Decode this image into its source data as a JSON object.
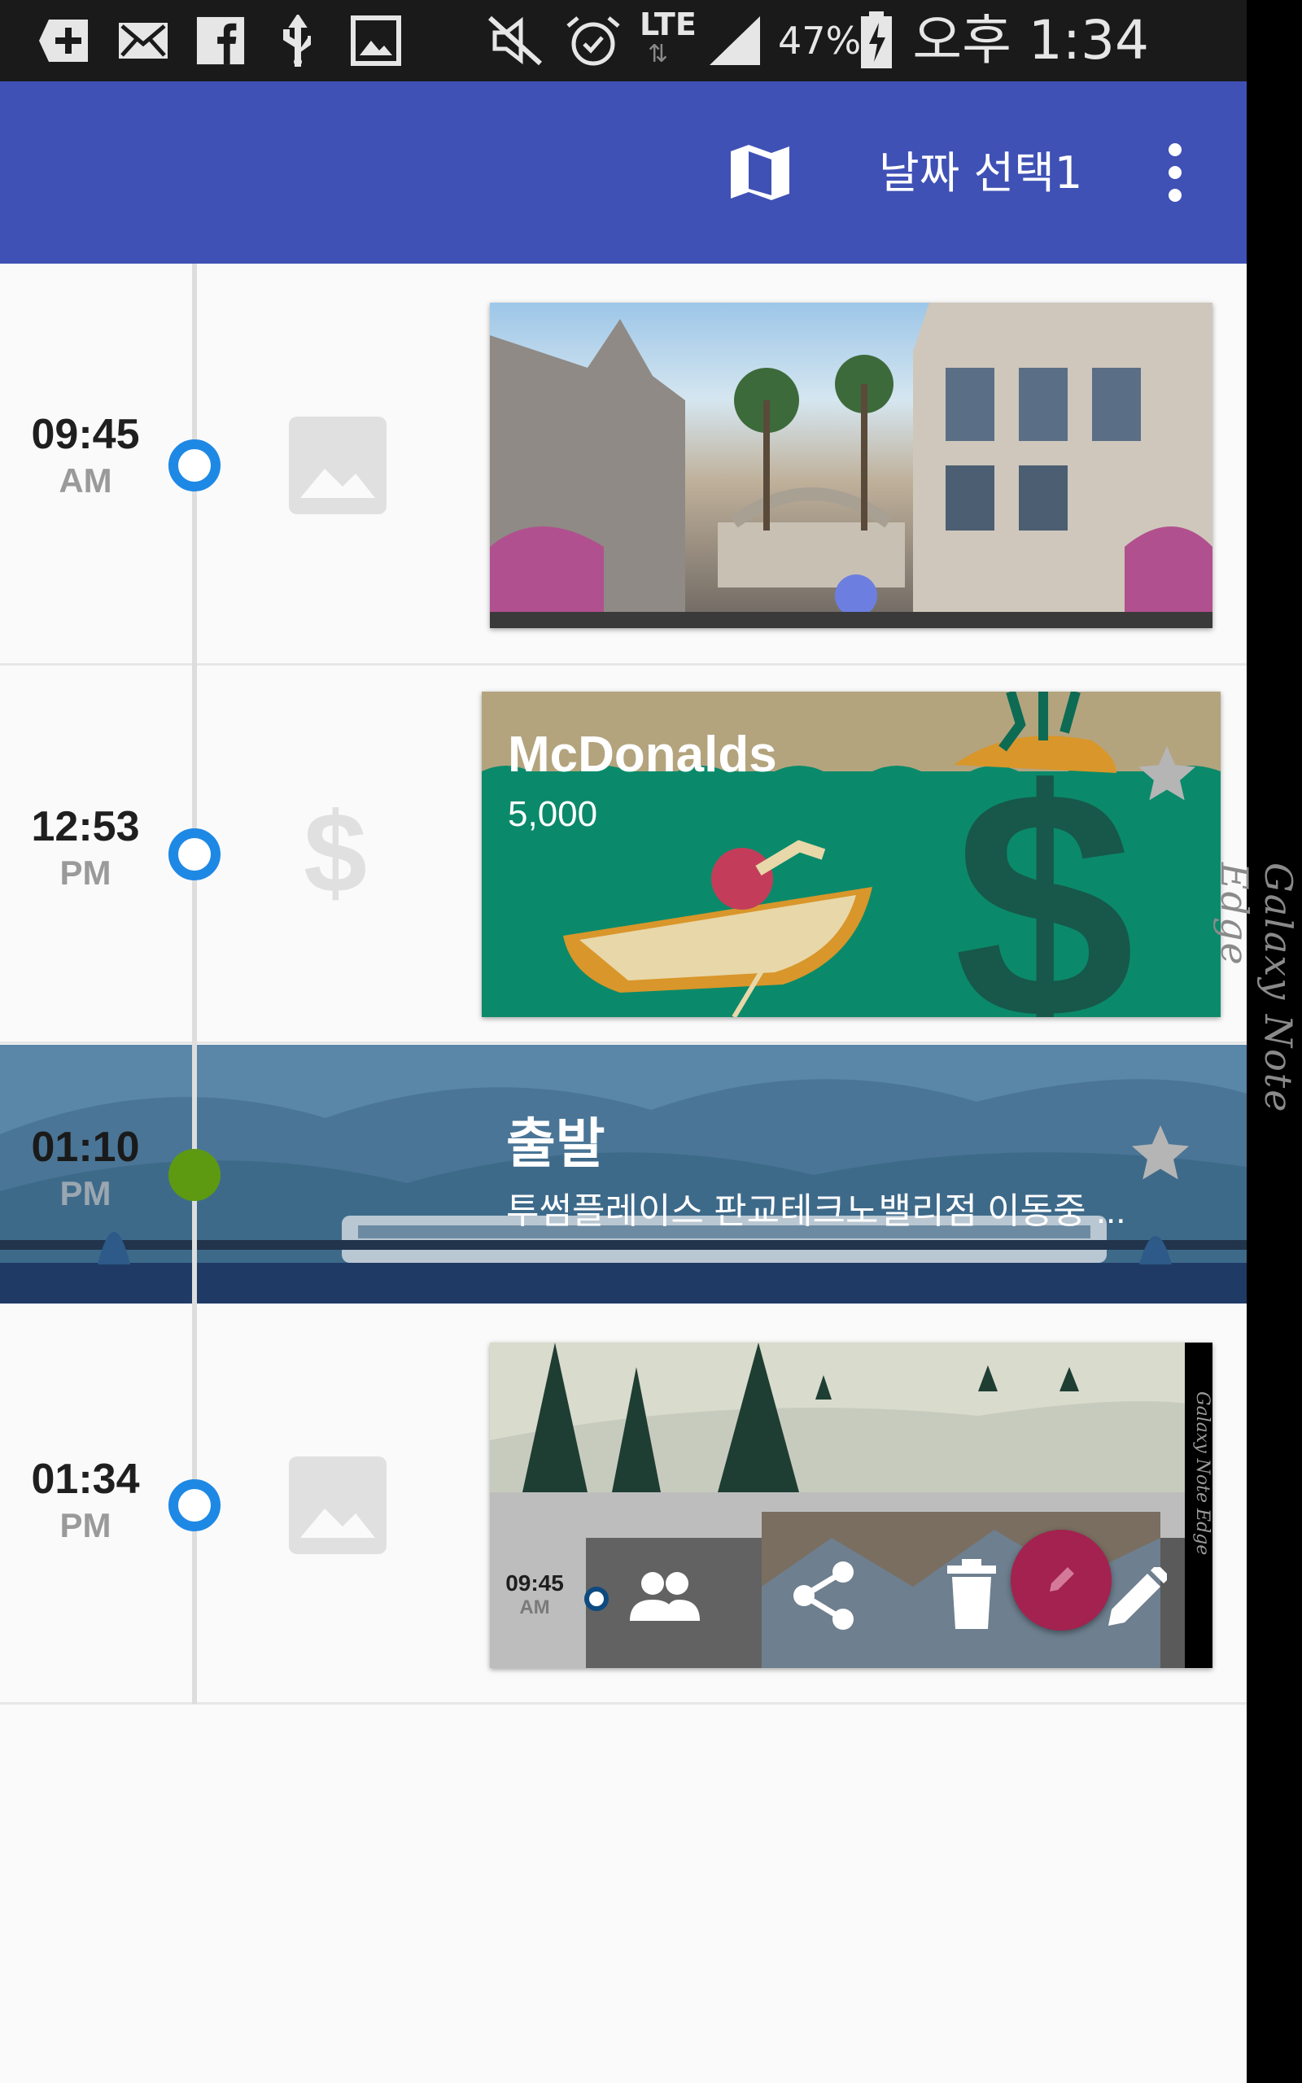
{
  "status_bar": {
    "battery_percent": "47%",
    "network": "LTE",
    "time": "오후 1:34",
    "icons": [
      "add-box-icon",
      "mail-icon",
      "facebook-icon",
      "usb-icon",
      "image-icon",
      "mute-icon",
      "alarm-icon",
      "lte-icon",
      "signal-icon",
      "battery-charging-icon"
    ]
  },
  "app_bar": {
    "map_icon": "map-icon",
    "date_select_label": "날짜 선택1",
    "overflow_icon": "more-vert-icon",
    "color": "#3f51b5"
  },
  "timeline": {
    "items": [
      {
        "time": "09:45",
        "ampm": "AM",
        "type_icon": "image-icon",
        "kind": "photo"
      },
      {
        "time": "12:53",
        "ampm": "PM",
        "type_icon": "dollar-icon",
        "kind": "expense",
        "title": "McDonalds",
        "subtitle": "5,000",
        "star": "star-icon"
      },
      {
        "time": "01:10",
        "ampm": "PM",
        "kind": "movement",
        "title": "출발",
        "subtitle": "투썸플레이스 판교테크노밸리점  이동중 ...",
        "star": "star-icon"
      },
      {
        "time": "01:34",
        "ampm": "PM",
        "type_icon": "image-icon",
        "kind": "photo"
      }
    ]
  },
  "nested_screenshot": {
    "time": "09:45",
    "ampm": "AM",
    "actions": [
      "people-icon",
      "share-icon",
      "delete-icon",
      "edit-icon"
    ],
    "edge_label": "Galaxy Note Edge"
  },
  "device_edge_label": "Galaxy Note Edge",
  "colors": {
    "accent_dot": "#1e88e5",
    "movement_dot": "#5d9a12",
    "fab": "#a3224f"
  }
}
